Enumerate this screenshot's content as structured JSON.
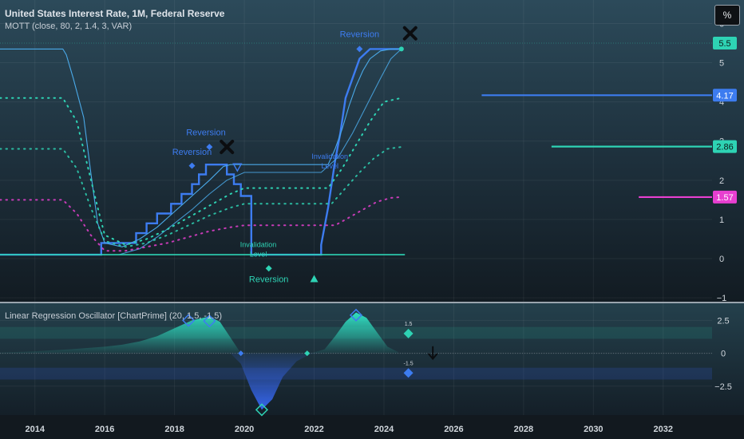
{
  "header": {
    "title": "United States Interest Rate, 1M, Federal Reserve",
    "indicator": "MOTT (close, 80, 2, 1.4, 3, VAR)",
    "unit": "%"
  },
  "colors": {
    "background_top": "#2c4a5a",
    "background_bottom": "#131e26",
    "rate_line": "#3d7cf0",
    "upper_band": "#4aa9e8",
    "teal": "#2ed3b4",
    "pink": "#e83fd0",
    "blue_signal": "#3b6fef",
    "teal_fill": "#27d6b8",
    "blue_fill": "#3566ee",
    "axis_text": "#d0d6dc"
  },
  "chart_data": [
    {
      "type": "line",
      "panel": "main",
      "title": "United States Interest Rate, 1M, Federal Reserve",
      "x_ticks": [
        "2014",
        "2016",
        "2018",
        "2020",
        "2022",
        "2024",
        "2026",
        "2028",
        "2030",
        "2032"
      ],
      "x_tick_values": [
        2014,
        2016,
        2018,
        2020,
        2022,
        2024,
        2026,
        2028,
        2030,
        2032
      ],
      "xlim": [
        2013.0,
        2033.4
      ],
      "y_ticks": [
        "6",
        "5",
        "4",
        "3",
        "2",
        "1",
        "0",
        "−1"
      ],
      "y_tick_values": [
        6,
        5,
        4,
        3,
        2,
        1,
        0,
        -1
      ],
      "ylim": [
        -1.1,
        6.6
      ],
      "series": [
        {
          "role": "rate",
          "x": [
            2013.0,
            2015.9,
            2015.9,
            2016.3,
            2016.9,
            2016.9,
            2017.2,
            2017.2,
            2017.5,
            2017.5,
            2017.9,
            2017.9,
            2018.2,
            2018.2,
            2018.5,
            2018.5,
            2018.7,
            2018.7,
            2018.9,
            2018.9,
            2019.5,
            2019.5,
            2019.7,
            2019.7,
            2019.9,
            2019.9,
            2020.2,
            2020.2,
            2022.2,
            2022.2,
            2022.4,
            2022.6,
            2022.75,
            2022.9,
            2023.1,
            2023.3,
            2023.6,
            2024.5
          ],
          "y": [
            0.1,
            0.1,
            0.4,
            0.4,
            0.4,
            0.65,
            0.65,
            0.9,
            0.9,
            1.15,
            1.15,
            1.4,
            1.4,
            1.65,
            1.65,
            1.9,
            1.9,
            2.15,
            2.15,
            2.4,
            2.4,
            2.15,
            2.15,
            1.9,
            1.9,
            1.6,
            1.6,
            0.1,
            0.1,
            0.35,
            1.3,
            2.5,
            3.2,
            4.1,
            4.6,
            5.1,
            5.35,
            5.35
          ]
        },
        {
          "role": "upper_band",
          "x": [
            2013.0,
            2014.8,
            2014.9,
            2015.1,
            2015.4,
            2015.6,
            2015.8,
            2016.0,
            2016.5,
            2017.0,
            2017.5,
            2018.0,
            2018.5,
            2019.0,
            2019.4,
            2019.6,
            2020.0,
            2022.4,
            2022.6,
            2022.8,
            2023.0,
            2023.2,
            2023.4,
            2023.6,
            2023.9,
            2024.2,
            2024.5
          ],
          "y": [
            5.35,
            5.35,
            5.2,
            4.6,
            3.6,
            2.2,
            0.9,
            0.4,
            0.3,
            0.5,
            0.8,
            1.2,
            1.6,
            2.0,
            2.35,
            2.4,
            2.4,
            2.4,
            2.8,
            3.3,
            3.9,
            4.4,
            4.8,
            5.1,
            5.3,
            5.35,
            5.35
          ]
        },
        {
          "role": "lower_band",
          "x": [
            2016.4,
            2017.0,
            2017.5,
            2018.0,
            2018.5,
            2019.0,
            2019.5,
            2020.0,
            2022.2,
            2022.7,
            2023.1,
            2023.5,
            2023.9,
            2024.2,
            2024.5
          ],
          "y": [
            0.1,
            0.25,
            0.55,
            0.9,
            1.25,
            1.65,
            2.0,
            2.2,
            2.2,
            2.6,
            3.2,
            3.9,
            4.6,
            5.1,
            5.35
          ]
        },
        {
          "role": "dotted_upper",
          "x": [
            2013.0,
            2014.8,
            2015.2,
            2015.5,
            2015.8,
            2016.0,
            2016.6,
            2017.2,
            2017.8,
            2018.4,
            2019.0,
            2019.6,
            2020.0,
            2022.4,
            2022.8,
            2023.2,
            2023.6,
            2024.0,
            2024.5
          ],
          "y": [
            4.1,
            4.1,
            3.5,
            2.4,
            1.3,
            0.6,
            0.35,
            0.5,
            0.75,
            1.05,
            1.35,
            1.65,
            1.8,
            1.8,
            2.3,
            2.9,
            3.5,
            4.0,
            4.1
          ]
        },
        {
          "role": "dotted_teal",
          "x": [
            2013.0,
            2014.8,
            2015.2,
            2015.6,
            2016.0,
            2016.6,
            2017.2,
            2017.8,
            2018.4,
            2019.0,
            2019.6,
            2020.0,
            2022.5,
            2022.9,
            2023.3,
            2023.7,
            2024.1,
            2024.5
          ],
          "y": [
            2.8,
            2.8,
            2.3,
            1.3,
            0.45,
            0.3,
            0.4,
            0.6,
            0.85,
            1.1,
            1.3,
            1.4,
            1.4,
            1.8,
            2.2,
            2.55,
            2.8,
            2.85
          ]
        },
        {
          "role": "dotted_pink",
          "x": [
            2013.0,
            2014.8,
            2015.2,
            2015.6,
            2016.0,
            2016.6,
            2017.2,
            2017.8,
            2018.4,
            2019.0,
            2019.6,
            2020.0,
            2022.6,
            2023.0,
            2023.4,
            2023.8,
            2024.2,
            2024.5
          ],
          "y": [
            1.5,
            1.5,
            1.15,
            0.6,
            0.2,
            0.2,
            0.3,
            0.4,
            0.55,
            0.7,
            0.8,
            0.85,
            0.85,
            1.05,
            1.25,
            1.45,
            1.55,
            1.57
          ]
        }
      ],
      "price_labels": [
        {
          "value": 5.5,
          "text": "5.5",
          "color": "#2ed3b4"
        },
        {
          "value": 4.17,
          "text": "4.17",
          "color": "#3d7cf0"
        },
        {
          "value": 2.86,
          "text": "2.86",
          "color": "#2ed3b4"
        },
        {
          "value": 1.57,
          "text": "1.57",
          "color": "#e83fd0"
        }
      ],
      "levels": [
        {
          "value": 4.17,
          "x_from": 2026.8,
          "color": "#3d7cf0"
        },
        {
          "value": 2.86,
          "x_from": 2028.8,
          "color": "#2ed3b4"
        },
        {
          "value": 1.57,
          "x_from": 2031.3,
          "color": "#e83fd0"
        }
      ],
      "annotations": [
        {
          "text": "Reversion",
          "x": 2018.9,
          "y": 3.15,
          "color": "#3d7cf0"
        },
        {
          "text": "Reversion",
          "x": 2018.5,
          "y": 2.65,
          "color": "#3d7cf0"
        },
        {
          "text": "Reversion",
          "x": 2023.3,
          "y": 5.65,
          "color": "#3d7cf0"
        },
        {
          "text": "Reversion",
          "x": 2020.7,
          "y": -0.6,
          "color": "#2ed3b4"
        },
        {
          "text": "Invalidation",
          "x": 2020.4,
          "y": 0.3,
          "color": "#2ed3b4"
        },
        {
          "text": "Level",
          "x": 2020.4,
          "y": 0.05,
          "color": "#2ed3b4"
        },
        {
          "text": "Invalidation",
          "x": 2022.45,
          "y": 2.55,
          "color": "#3d7cf0"
        },
        {
          "text": "Level",
          "x": 2022.45,
          "y": 2.3,
          "color": "#3d7cf0"
        }
      ]
    },
    {
      "type": "area",
      "panel": "oscillator",
      "title": "Linear Regression Oscillator [ChartPrime] (20, 1.5, -1.5)",
      "y_ticks": [
        "2.5",
        "0",
        "−2.5"
      ],
      "y_tick_values": [
        2.5,
        0,
        -2.5
      ],
      "ylim": [
        -4.7,
        3.8
      ],
      "threshold_labels": [
        "1.5",
        "-1.5"
      ],
      "threshold_values": [
        1.5,
        -1.5
      ],
      "x": [
        2013.0,
        2014.0,
        2015.0,
        2016.0,
        2016.5,
        2017.0,
        2017.5,
        2018.0,
        2018.5,
        2019.0,
        2019.3,
        2019.6,
        2019.9,
        2020.2,
        2020.5,
        2020.8,
        2021.1,
        2021.5,
        2021.9,
        2022.3,
        2022.6,
        2022.9,
        2023.2,
        2023.5,
        2023.8,
        2024.1,
        2024.4
      ],
      "values": [
        0.05,
        0.15,
        0.3,
        0.5,
        0.65,
        0.9,
        1.3,
        1.9,
        2.5,
        2.8,
        2.4,
        1.2,
        -0.8,
        -2.8,
        -4.3,
        -3.5,
        -1.8,
        -0.6,
        -0.05,
        0.3,
        1.3,
        2.4,
        3.1,
        2.7,
        1.6,
        0.5,
        0.1
      ]
    }
  ]
}
